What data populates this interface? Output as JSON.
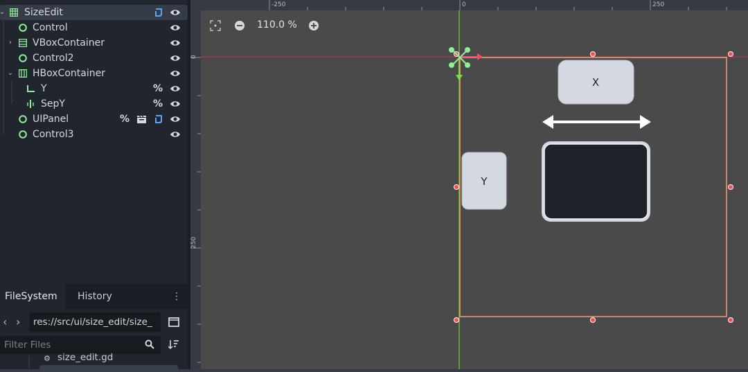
{
  "scene_tree": {
    "nodes": [
      {
        "label": "SizeEdit",
        "icon": "grid-container-icon",
        "selected": true,
        "has_script": true
      },
      {
        "label": "Control",
        "icon": "control-icon"
      },
      {
        "label": "VBoxContainer",
        "icon": "vbox-container-icon",
        "collapsed": true
      },
      {
        "label": "Control2",
        "icon": "control-icon"
      },
      {
        "label": "HBoxContainer",
        "icon": "hbox-container-icon",
        "expanded": true
      },
      {
        "label": "Y",
        "icon": "label-icon",
        "badge": "%"
      },
      {
        "label": "SepY",
        "icon": "vseparator-icon",
        "badge": "%"
      },
      {
        "label": "UIPanel",
        "icon": "control-icon",
        "badge": "%",
        "has_clapper": true,
        "has_script": true
      },
      {
        "label": "Control3",
        "icon": "control-icon"
      }
    ]
  },
  "filesystem": {
    "tabs": [
      "FileSystem",
      "History"
    ],
    "path": "res://src/ui/size_edit/size_",
    "filter_placeholder": "Filter Files",
    "visible_file": "size_edit.gd"
  },
  "viewport": {
    "zoom_label": "110.0 %",
    "ruler_top_ticks": [
      "-250",
      "0",
      "250"
    ],
    "ruler_left_ticks": [
      "0",
      "250"
    ],
    "node_x_label": "X",
    "node_y_label": "Y"
  },
  "colors": {
    "accent_green": "#8eef97",
    "selection_orange": "#f39c72",
    "handle_red": "#ff4b4b",
    "viewport_bg": "#4a4a4a"
  }
}
